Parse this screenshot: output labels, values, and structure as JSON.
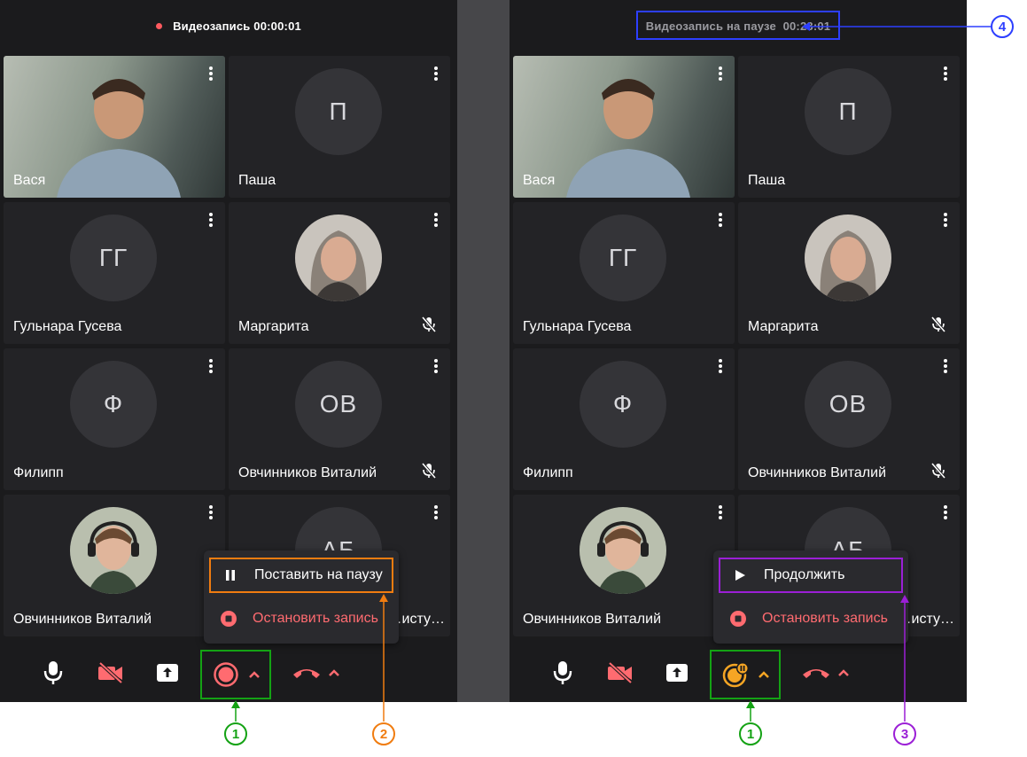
{
  "left": {
    "recording_status": "Видеозапись 00:00:01",
    "tiles": [
      {
        "name": "Вася",
        "initials": ""
      },
      {
        "name": "Паша",
        "initials": "П"
      },
      {
        "name": "Гульнара Гусева",
        "initials": "ГГ"
      },
      {
        "name": "Маргарита",
        "initials": ""
      },
      {
        "name": "Филипп",
        "initials": "Ф"
      },
      {
        "name": "Овчинников Виталий",
        "initials": "ОВ"
      },
      {
        "name": "Овчинников Виталий",
        "initials": ""
      },
      {
        "name": "…исту…",
        "initials": "АБ"
      }
    ],
    "menu": {
      "first": "Поставить на паузу",
      "second": "Остановить запись"
    }
  },
  "right": {
    "recording_status": "Видеозапись на паузе  00:23:01",
    "tiles": [
      {
        "name": "Вася",
        "initials": ""
      },
      {
        "name": "Паша",
        "initials": "П"
      },
      {
        "name": "Гульнара Гусева",
        "initials": "ГГ"
      },
      {
        "name": "Маргарита",
        "initials": ""
      },
      {
        "name": "Филипп",
        "initials": "Ф"
      },
      {
        "name": "Овчинников Виталий",
        "initials": "ОВ"
      },
      {
        "name": "Овчинников Виталий",
        "initials": ""
      },
      {
        "name": "…исту…",
        "initials": "АБ"
      }
    ],
    "menu": {
      "first": "Продолжить",
      "second": "Остановить запись"
    }
  },
  "callouts": {
    "c1a": "1",
    "c2": "2",
    "c1b": "1",
    "c3": "3",
    "c4": "4"
  },
  "colors": {
    "accent_red": "#ff5a5f",
    "accent_orange": "#f5a524",
    "callout_green": "#14a214",
    "callout_orange": "#f07c10",
    "callout_purple": "#9b1fd6",
    "callout_blue": "#2d3fff"
  }
}
